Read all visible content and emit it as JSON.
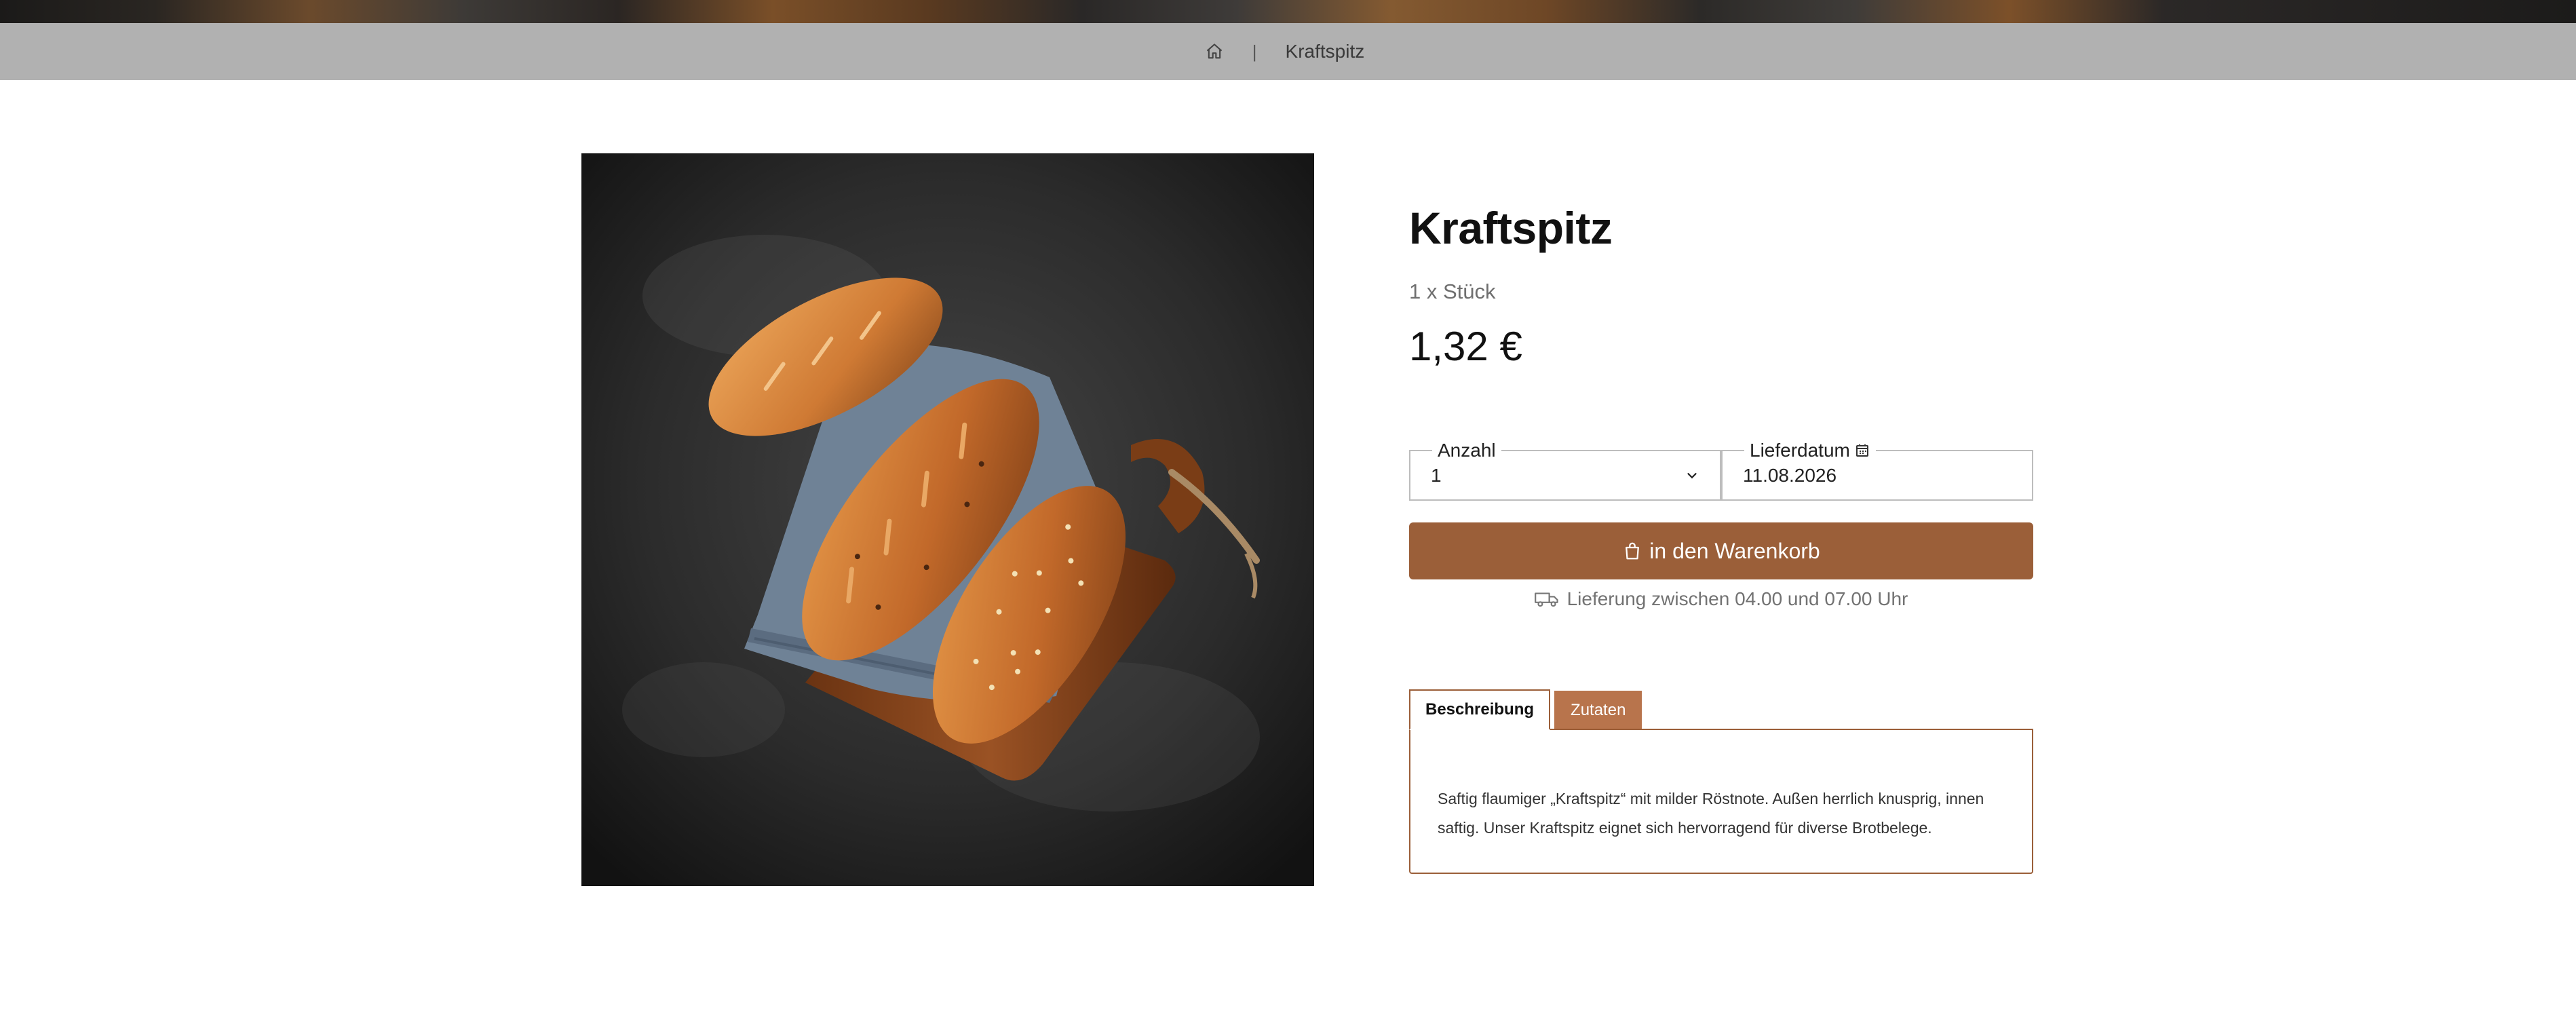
{
  "breadcrumb": {
    "home_icon": "home-icon",
    "separator": "|",
    "current": "Kraftspitz"
  },
  "product": {
    "title": "Kraftspitz",
    "unit": "1 x Stück",
    "price": "1,32 €",
    "image_alt": "Kraftspitz Brötchen"
  },
  "order": {
    "quantity_label": "Anzahl",
    "quantity_value": "1",
    "date_label": "Lieferdatum",
    "date_value": "11.08.2026",
    "cart_button": "in den Warenkorb",
    "delivery_text": "Lieferung zwischen 04.00 und 07.00 Uhr"
  },
  "tabs": {
    "items": [
      {
        "label": "Beschreibung",
        "active": true
      },
      {
        "label": "Zutaten",
        "active": false
      }
    ],
    "description": "Saftig flaumiger „Kraftspitz“ mit milder Röstnote. Außen herrlich knusprig, innen saftig. Unser Kraftspitz eignet sich hervorragend für diverse Brotbelege."
  },
  "colors": {
    "accent": "#9b5f39",
    "tab_inactive": "#b8744c",
    "breadcrumb_bg": "#b1b1b1"
  }
}
